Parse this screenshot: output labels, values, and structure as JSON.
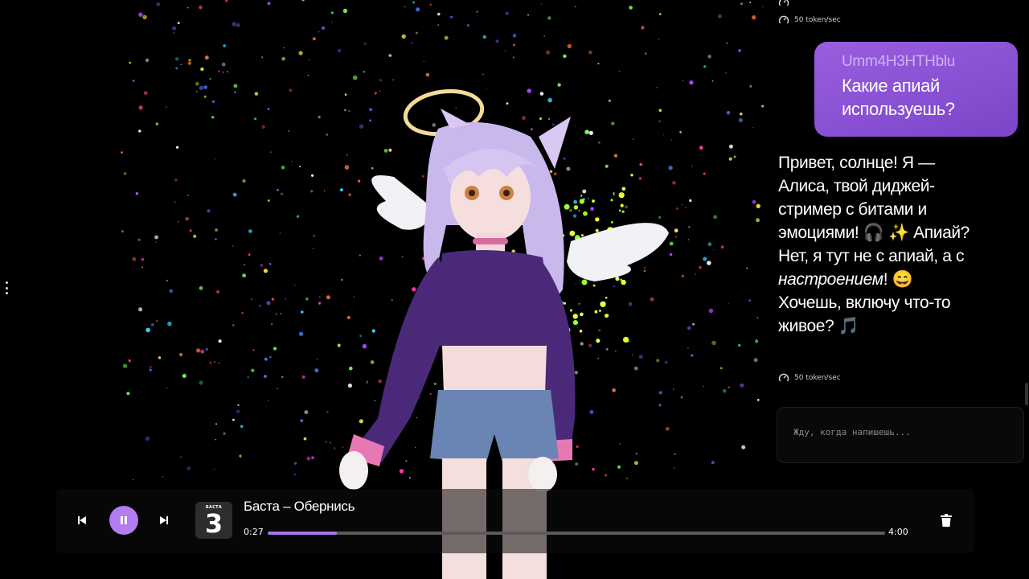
{
  "chat": {
    "prev_meta": "50 token/sec",
    "user_message": {
      "name": "Umm4H3HTHblu",
      "text": "Какие апиай используешь?"
    },
    "bot_message": {
      "line1": "Привет, солнце! Я — Алиса, твой диджей-стример с битами и эмоциями! 🎧 ✨ Апиай? Нет, я тут не с апиай, а с ",
      "emphasis": "настроением",
      "line2": "! 😄 Хочешь, включу что-то живое? 🎵"
    },
    "bot_meta": "50 token/sec",
    "input_placeholder": "Жду, когда напишешь..."
  },
  "player": {
    "track_title": "Баста – Обернись",
    "cover_label": "БАСТА",
    "cover_number": "3",
    "current_time": "0:27",
    "duration": "4:00",
    "progress": 0.112
  },
  "icons": {
    "prev": "skip-previous-icon",
    "play_pause": "pause-icon",
    "next": "skip-next-icon",
    "delete": "trash-icon",
    "speed": "gauge-icon",
    "menu": "vertical-dots-icon"
  },
  "colors": {
    "accent": "#b47cf2",
    "user_bubble": "#8a52d6",
    "progress_fill": "#a874ea"
  }
}
